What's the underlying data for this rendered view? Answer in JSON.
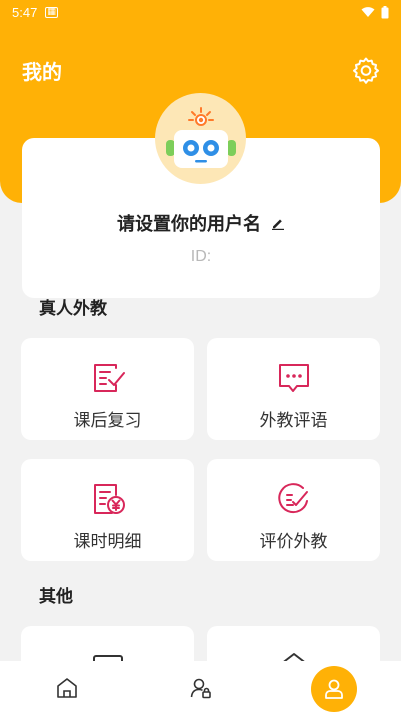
{
  "status_bar": {
    "time": "5:47",
    "sim_icon": "sim-card-icon",
    "icons": [
      "wifi-icon",
      "battery-icon"
    ]
  },
  "header": {
    "title": "我的",
    "settings_icon": "gear-icon"
  },
  "profile": {
    "username": "请设置你的用户名",
    "id_label": "ID:",
    "avatar_icon": "robot-avatar",
    "edit_icon": "pencil-icon"
  },
  "sections": {
    "real_teacher": {
      "title": "真人外教",
      "tiles": [
        {
          "label": "课后复习",
          "icon": "review-notes-icon"
        },
        {
          "label": "外教评语",
          "icon": "comment-bubble-icon"
        },
        {
          "label": "课时明细",
          "icon": "yuan-receipt-icon"
        },
        {
          "label": "评价外教",
          "icon": "rating-checklist-icon"
        }
      ]
    },
    "other": {
      "title": "其他",
      "tiles": [
        {
          "label": "",
          "icon": "card-icon"
        },
        {
          "label": "",
          "icon": "house-icon"
        }
      ]
    }
  },
  "bottom_nav": [
    {
      "name": "home",
      "icon": "home-icon",
      "active": false
    },
    {
      "name": "teacher",
      "icon": "user-lock-icon",
      "active": false
    },
    {
      "name": "mine",
      "icon": "person-icon",
      "active": true
    }
  ],
  "colors": {
    "brand": "#ffb106",
    "icon_accent": "#d8275a",
    "avatar_bg": "#fde7b6"
  }
}
